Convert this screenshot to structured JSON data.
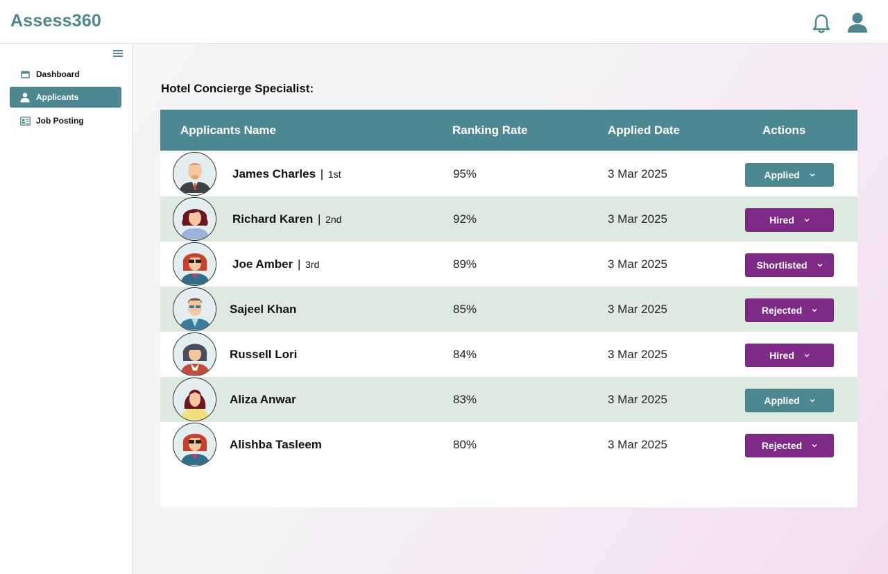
{
  "app": {
    "brand": "Assess360"
  },
  "sidebar": {
    "items": [
      {
        "label": "Dashboard",
        "icon": "calendar-icon"
      },
      {
        "label": "Applicants",
        "icon": "person-icon"
      },
      {
        "label": "Job Posting",
        "icon": "id-card-icon"
      }
    ]
  },
  "page": {
    "title": "Hotel Concierge Specialist:"
  },
  "table": {
    "headers": [
      "Applicants Name",
      "Ranking Rate",
      "Applied Date",
      "Actions"
    ],
    "rows": [
      {
        "name": "James Charles",
        "sep": "|",
        "rank": "1st",
        "rate": "95%",
        "date": "3 Mar 2025",
        "status": "Applied"
      },
      {
        "name": "Richard Karen",
        "sep": "|",
        "rank": "2nd",
        "rate": "92%",
        "date": "3 Mar 2025",
        "status": "Hired"
      },
      {
        "name": "Joe Amber",
        "sep": "|",
        "rank": "3rd",
        "rate": "89%",
        "date": "3 Mar 2025",
        "status": "Shortlisted"
      },
      {
        "name": "Sajeel Khan",
        "rate": "85%",
        "date": "3 Mar 2025",
        "status": "Rejected"
      },
      {
        "name": "Russell Lori",
        "rate": "84%",
        "date": "3 Mar 2025",
        "status": "Hired"
      },
      {
        "name": "Aliza Anwar",
        "rate": "83%",
        "date": "3 Mar 2025",
        "status": "Applied"
      },
      {
        "name": "Alishba Tasleem",
        "rate": "80%",
        "date": "3 Mar 2025",
        "status": "Rejected"
      }
    ]
  },
  "colors": {
    "teal": "#4b8891",
    "purple": "#7f2a86",
    "row_alt": "#ddeadf"
  }
}
